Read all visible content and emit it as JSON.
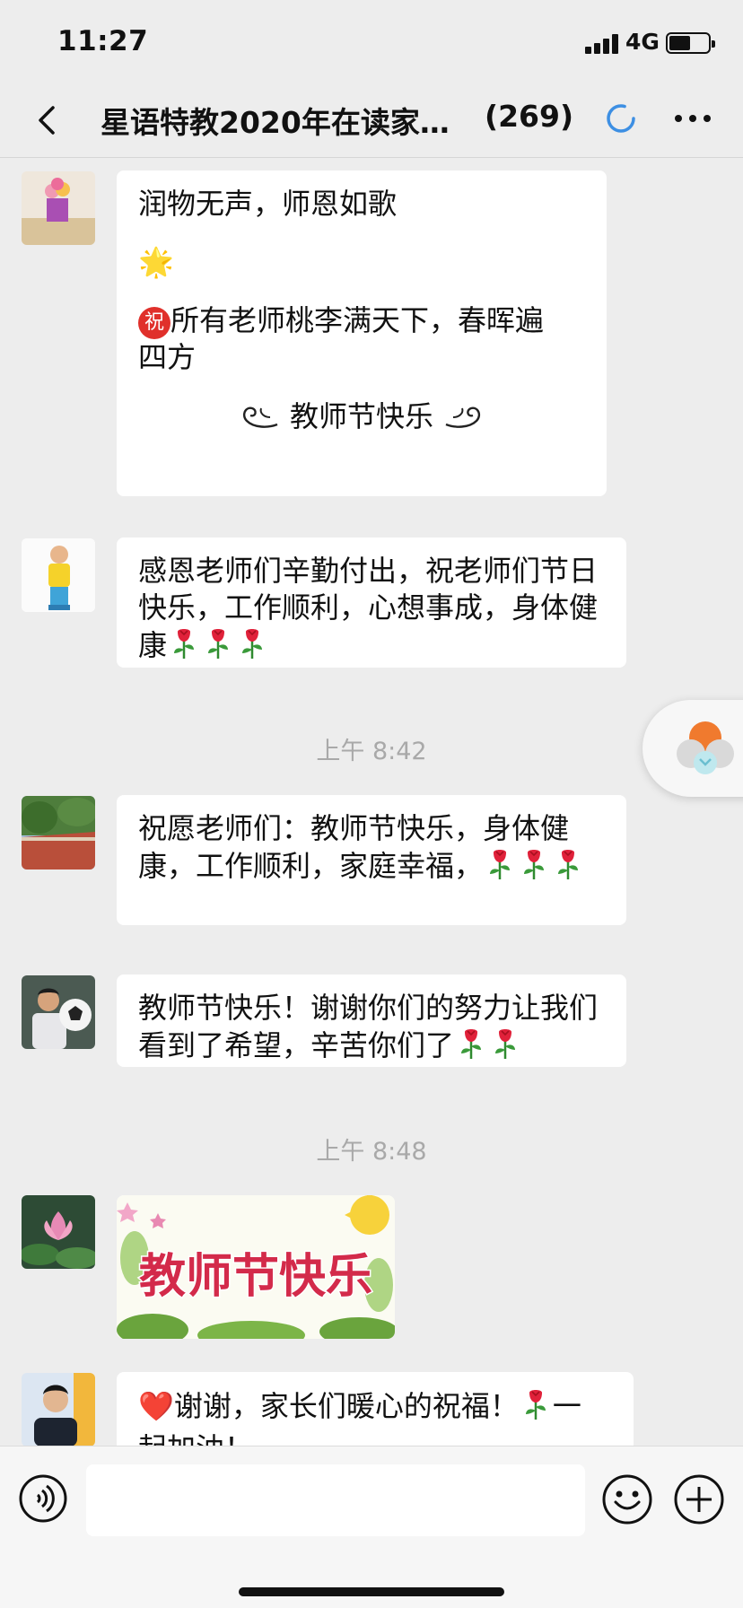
{
  "status_bar": {
    "time": "11:27",
    "network": "4G",
    "battery_level": 0.55
  },
  "header": {
    "title": "星语特教2020年在读家…",
    "member_count": "(269)"
  },
  "messages": [
    {
      "lines": [
        "润物无声，师恩如歌"
      ],
      "star": "🌟",
      "blessing_icon": "祝",
      "text2": "所有老师桃李满天下，春晖遍",
      "text3": "四方",
      "footer": "教师节快乐"
    },
    {
      "text": "感恩老师们辛勤付出，祝老师们节日快乐，工作顺利，心想事成，身体健康",
      "rose_count": 3
    },
    {
      "timestamp": "上午 8:42"
    },
    {
      "text": "祝愿老师们：教师节快乐，身体健康，工作顺利，家庭幸福，",
      "rose_count": 3
    },
    {
      "text": "教师节快乐！谢谢你们的努力让我们看到了希望，辛苦你们了",
      "rose_count": 2
    },
    {
      "timestamp": "上午 8:48"
    },
    {
      "image_text": "教师节快乐"
    },
    {
      "heart": "❤️",
      "text": "谢谢，家长们暖心的祝福！",
      "text_after": "一",
      "text_cut": "起加油！"
    }
  ],
  "icons": {
    "back": "back-chevron-icon",
    "loading": "loading-circle-icon",
    "more": "more-dots-icon",
    "voice": "voice-icon",
    "emoji": "emoji-icon",
    "plus": "plus-icon",
    "rose": "rose-icon",
    "float": "floating-ball-icon"
  },
  "colors": {
    "background": "#ededed",
    "bubble": "#ffffff",
    "accent": "#3d8fe3",
    "timestamp": "#a9a9a9",
    "blessing_red": "#e0302b"
  }
}
